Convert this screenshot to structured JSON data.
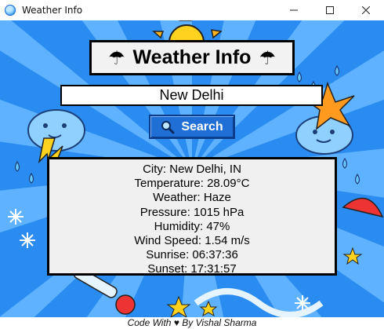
{
  "window": {
    "title": "Weather Info",
    "buttons": {
      "minimize": "minimize",
      "maximize": "maximize",
      "close": "close"
    }
  },
  "header": {
    "title": "Weather Info",
    "left_icon": "☂",
    "right_icon": "☂"
  },
  "search": {
    "city_value": "New Delhi",
    "button_icon": "magnifier-icon",
    "button_label": "Search"
  },
  "weather": {
    "lines": [
      "City: New Delhi, IN",
      "Temperature: 28.09°C",
      "Weather: Haze",
      "Pressure: 1015 hPa",
      "Humidity: 47%",
      "Wind Speed: 1.54 m/s",
      "Sunrise: 06:37:36",
      "Sunset: 17:31:57"
    ]
  },
  "footer": {
    "credit": "Code With ♥ By Vishal Sharma"
  },
  "colors": {
    "background_blue": "#2a8cf0",
    "ray_blue": "#5fb2ff",
    "button_blue": "#1f6fd6"
  }
}
